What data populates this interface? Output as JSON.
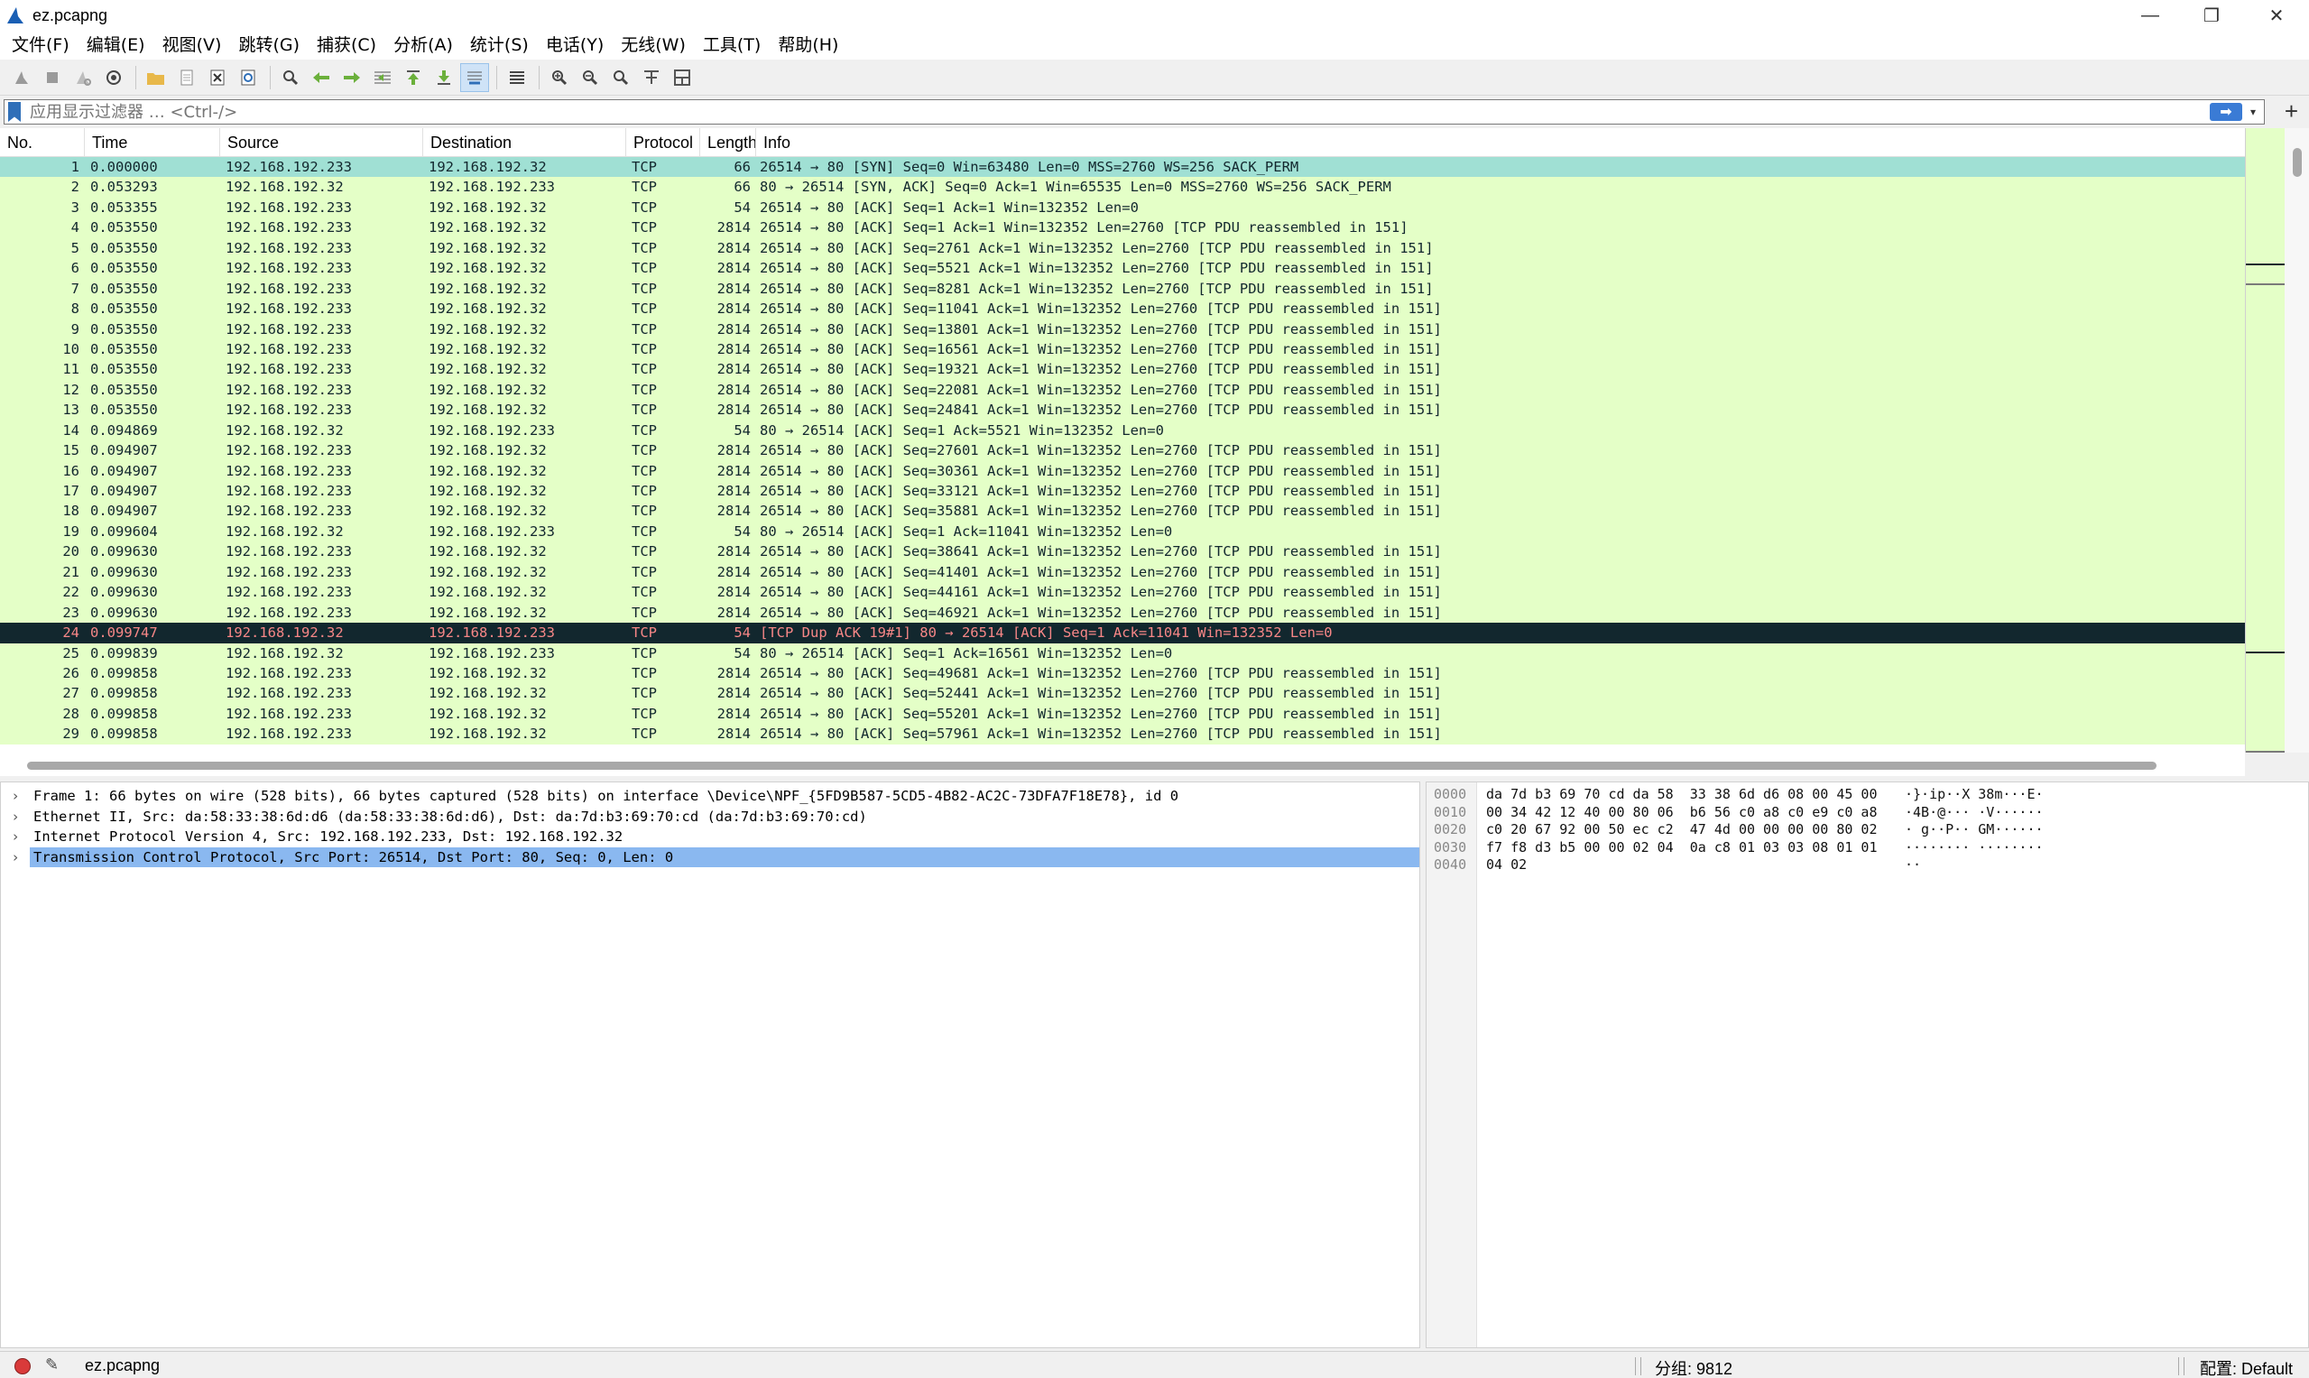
{
  "window": {
    "title": "ez.pcapng",
    "minimize": "—",
    "restore": "❐",
    "close": "✕"
  },
  "menu": [
    "文件(F)",
    "编辑(E)",
    "视图(V)",
    "跳转(G)",
    "捕获(C)",
    "分析(A)",
    "统计(S)",
    "电话(Y)",
    "无线(W)",
    "工具(T)",
    "帮助(H)"
  ],
  "filter": {
    "placeholder": "应用显示过滤器 … <Ctrl-/>",
    "apply_glyph": "➡",
    "dropdown_glyph": "▾",
    "add_glyph": "+"
  },
  "columns": [
    "No.",
    "Time",
    "Source",
    "Destination",
    "Protocol",
    "Length",
    "Info"
  ],
  "packets": [
    {
      "no": "1",
      "time": "0.000000",
      "src": "192.168.192.233",
      "dst": "192.168.192.32",
      "proto": "TCP",
      "len": "66",
      "info": "26514 → 80 [SYN] Seq=0 Win=63480 Len=0 MSS=2760 WS=256 SACK_PERM",
      "style": "selected-cyan"
    },
    {
      "no": "2",
      "time": "0.053293",
      "src": "192.168.192.32",
      "dst": "192.168.192.233",
      "proto": "TCP",
      "len": "66",
      "info": "80 → 26514 [SYN, ACK] Seq=0 Ack=1 Win=65535 Len=0 MSS=2760 WS=256 SACK_PERM",
      "style": ""
    },
    {
      "no": "3",
      "time": "0.053355",
      "src": "192.168.192.233",
      "dst": "192.168.192.32",
      "proto": "TCP",
      "len": "54",
      "info": "26514 → 80 [ACK] Seq=1 Ack=1 Win=132352 Len=0",
      "style": ""
    },
    {
      "no": "4",
      "time": "0.053550",
      "src": "192.168.192.233",
      "dst": "192.168.192.32",
      "proto": "TCP",
      "len": "2814",
      "info": "26514 → 80 [ACK] Seq=1 Ack=1 Win=132352 Len=2760 [TCP PDU reassembled in 151]",
      "style": ""
    },
    {
      "no": "5",
      "time": "0.053550",
      "src": "192.168.192.233",
      "dst": "192.168.192.32",
      "proto": "TCP",
      "len": "2814",
      "info": "26514 → 80 [ACK] Seq=2761 Ack=1 Win=132352 Len=2760 [TCP PDU reassembled in 151]",
      "style": ""
    },
    {
      "no": "6",
      "time": "0.053550",
      "src": "192.168.192.233",
      "dst": "192.168.192.32",
      "proto": "TCP",
      "len": "2814",
      "info": "26514 → 80 [ACK] Seq=5521 Ack=1 Win=132352 Len=2760 [TCP PDU reassembled in 151]",
      "style": ""
    },
    {
      "no": "7",
      "time": "0.053550",
      "src": "192.168.192.233",
      "dst": "192.168.192.32",
      "proto": "TCP",
      "len": "2814",
      "info": "26514 → 80 [ACK] Seq=8281 Ack=1 Win=132352 Len=2760 [TCP PDU reassembled in 151]",
      "style": ""
    },
    {
      "no": "8",
      "time": "0.053550",
      "src": "192.168.192.233",
      "dst": "192.168.192.32",
      "proto": "TCP",
      "len": "2814",
      "info": "26514 → 80 [ACK] Seq=11041 Ack=1 Win=132352 Len=2760 [TCP PDU reassembled in 151]",
      "style": ""
    },
    {
      "no": "9",
      "time": "0.053550",
      "src": "192.168.192.233",
      "dst": "192.168.192.32",
      "proto": "TCP",
      "len": "2814",
      "info": "26514 → 80 [ACK] Seq=13801 Ack=1 Win=132352 Len=2760 [TCP PDU reassembled in 151]",
      "style": ""
    },
    {
      "no": "10",
      "time": "0.053550",
      "src": "192.168.192.233",
      "dst": "192.168.192.32",
      "proto": "TCP",
      "len": "2814",
      "info": "26514 → 80 [ACK] Seq=16561 Ack=1 Win=132352 Len=2760 [TCP PDU reassembled in 151]",
      "style": ""
    },
    {
      "no": "11",
      "time": "0.053550",
      "src": "192.168.192.233",
      "dst": "192.168.192.32",
      "proto": "TCP",
      "len": "2814",
      "info": "26514 → 80 [ACK] Seq=19321 Ack=1 Win=132352 Len=2760 [TCP PDU reassembled in 151]",
      "style": ""
    },
    {
      "no": "12",
      "time": "0.053550",
      "src": "192.168.192.233",
      "dst": "192.168.192.32",
      "proto": "TCP",
      "len": "2814",
      "info": "26514 → 80 [ACK] Seq=22081 Ack=1 Win=132352 Len=2760 [TCP PDU reassembled in 151]",
      "style": ""
    },
    {
      "no": "13",
      "time": "0.053550",
      "src": "192.168.192.233",
      "dst": "192.168.192.32",
      "proto": "TCP",
      "len": "2814",
      "info": "26514 → 80 [ACK] Seq=24841 Ack=1 Win=132352 Len=2760 [TCP PDU reassembled in 151]",
      "style": ""
    },
    {
      "no": "14",
      "time": "0.094869",
      "src": "192.168.192.32",
      "dst": "192.168.192.233",
      "proto": "TCP",
      "len": "54",
      "info": "80 → 26514 [ACK] Seq=1 Ack=5521 Win=132352 Len=0",
      "style": ""
    },
    {
      "no": "15",
      "time": "0.094907",
      "src": "192.168.192.233",
      "dst": "192.168.192.32",
      "proto": "TCP",
      "len": "2814",
      "info": "26514 → 80 [ACK] Seq=27601 Ack=1 Win=132352 Len=2760 [TCP PDU reassembled in 151]",
      "style": ""
    },
    {
      "no": "16",
      "time": "0.094907",
      "src": "192.168.192.233",
      "dst": "192.168.192.32",
      "proto": "TCP",
      "len": "2814",
      "info": "26514 → 80 [ACK] Seq=30361 Ack=1 Win=132352 Len=2760 [TCP PDU reassembled in 151]",
      "style": ""
    },
    {
      "no": "17",
      "time": "0.094907",
      "src": "192.168.192.233",
      "dst": "192.168.192.32",
      "proto": "TCP",
      "len": "2814",
      "info": "26514 → 80 [ACK] Seq=33121 Ack=1 Win=132352 Len=2760 [TCP PDU reassembled in 151]",
      "style": ""
    },
    {
      "no": "18",
      "time": "0.094907",
      "src": "192.168.192.233",
      "dst": "192.168.192.32",
      "proto": "TCP",
      "len": "2814",
      "info": "26514 → 80 [ACK] Seq=35881 Ack=1 Win=132352 Len=2760 [TCP PDU reassembled in 151]",
      "style": ""
    },
    {
      "no": "19",
      "time": "0.099604",
      "src": "192.168.192.32",
      "dst": "192.168.192.233",
      "proto": "TCP",
      "len": "54",
      "info": "80 → 26514 [ACK] Seq=1 Ack=11041 Win=132352 Len=0",
      "style": ""
    },
    {
      "no": "20",
      "time": "0.099630",
      "src": "192.168.192.233",
      "dst": "192.168.192.32",
      "proto": "TCP",
      "len": "2814",
      "info": "26514 → 80 [ACK] Seq=38641 Ack=1 Win=132352 Len=2760 [TCP PDU reassembled in 151]",
      "style": ""
    },
    {
      "no": "21",
      "time": "0.099630",
      "src": "192.168.192.233",
      "dst": "192.168.192.32",
      "proto": "TCP",
      "len": "2814",
      "info": "26514 → 80 [ACK] Seq=41401 Ack=1 Win=132352 Len=2760 [TCP PDU reassembled in 151]",
      "style": ""
    },
    {
      "no": "22",
      "time": "0.099630",
      "src": "192.168.192.233",
      "dst": "192.168.192.32",
      "proto": "TCP",
      "len": "2814",
      "info": "26514 → 80 [ACK] Seq=44161 Ack=1 Win=132352 Len=2760 [TCP PDU reassembled in 151]",
      "style": ""
    },
    {
      "no": "23",
      "time": "0.099630",
      "src": "192.168.192.233",
      "dst": "192.168.192.32",
      "proto": "TCP",
      "len": "2814",
      "info": "26514 → 80 [ACK] Seq=46921 Ack=1 Win=132352 Len=2760 [TCP PDU reassembled in 151]",
      "style": ""
    },
    {
      "no": "24",
      "time": "0.099747",
      "src": "192.168.192.32",
      "dst": "192.168.192.233",
      "proto": "TCP",
      "len": "54",
      "info": "[TCP Dup ACK 19#1] 80 → 26514 [ACK] Seq=1 Ack=11041 Win=132352 Len=0",
      "style": "dark"
    },
    {
      "no": "25",
      "time": "0.099839",
      "src": "192.168.192.32",
      "dst": "192.168.192.233",
      "proto": "TCP",
      "len": "54",
      "info": "80 → 26514 [ACK] Seq=1 Ack=16561 Win=132352 Len=0",
      "style": ""
    },
    {
      "no": "26",
      "time": "0.099858",
      "src": "192.168.192.233",
      "dst": "192.168.192.32",
      "proto": "TCP",
      "len": "2814",
      "info": "26514 → 80 [ACK] Seq=49681 Ack=1 Win=132352 Len=2760 [TCP PDU reassembled in 151]",
      "style": ""
    },
    {
      "no": "27",
      "time": "0.099858",
      "src": "192.168.192.233",
      "dst": "192.168.192.32",
      "proto": "TCP",
      "len": "2814",
      "info": "26514 → 80 [ACK] Seq=52441 Ack=1 Win=132352 Len=2760 [TCP PDU reassembled in 151]",
      "style": ""
    },
    {
      "no": "28",
      "time": "0.099858",
      "src": "192.168.192.233",
      "dst": "192.168.192.32",
      "proto": "TCP",
      "len": "2814",
      "info": "26514 → 80 [ACK] Seq=55201 Ack=1 Win=132352 Len=2760 [TCP PDU reassembled in 151]",
      "style": ""
    },
    {
      "no": "29",
      "time": "0.099858",
      "src": "192.168.192.233",
      "dst": "192.168.192.32",
      "proto": "TCP",
      "len": "2814",
      "info": "26514 → 80 [ACK] Seq=57961 Ack=1 Win=132352 Len=2760 [TCP PDU reassembled in 151]",
      "style": ""
    }
  ],
  "details": [
    {
      "text": "Frame 1: 66 bytes on wire (528 bits), 66 bytes captured (528 bits) on interface \\Device\\NPF_{5FD9B587-5CD5-4B82-AC2C-73DFA7F18E78}, id 0",
      "selected": false
    },
    {
      "text": "Ethernet II, Src: da:58:33:38:6d:d6 (da:58:33:38:6d:d6), Dst: da:7d:b3:69:70:cd (da:7d:b3:69:70:cd)",
      "selected": false
    },
    {
      "text": "Internet Protocol Version 4, Src: 192.168.192.233, Dst: 192.168.192.32",
      "selected": false
    },
    {
      "text": "Transmission Control Protocol, Src Port: 26514, Dst Port: 80, Seq: 0, Len: 0",
      "selected": true
    }
  ],
  "hex": [
    {
      "offset": "0000",
      "bytes": "da 7d b3 69 70 cd da 58  33 38 6d d6 08 00 45 00",
      "ascii": "·}·ip··X 38m···E·"
    },
    {
      "offset": "0010",
      "bytes": "00 34 42 12 40 00 80 06  b6 56 c0 a8 c0 e9 c0 a8",
      "ascii": "·4B·@··· ·V······"
    },
    {
      "offset": "0020",
      "bytes": "c0 20 67 92 00 50 ec c2  47 4d 00 00 00 00 80 02",
      "ascii": "· g··P·· GM······"
    },
    {
      "offset": "0030",
      "bytes": "f7 f8 d3 b5 00 00 02 04  0a c8 01 03 03 08 01 01",
      "ascii": "········ ········"
    },
    {
      "offset": "0040",
      "bytes": "04 02",
      "ascii": "··"
    }
  ],
  "status": {
    "file": "ez.pcapng",
    "packets": "分组: 9812",
    "profile": "配置: Default"
  },
  "colors": {
    "tcp_row": "#e4ffc7",
    "selected_row": "#a0e0d4",
    "bad_row": "#12272e",
    "bad_text": "#f78787"
  }
}
